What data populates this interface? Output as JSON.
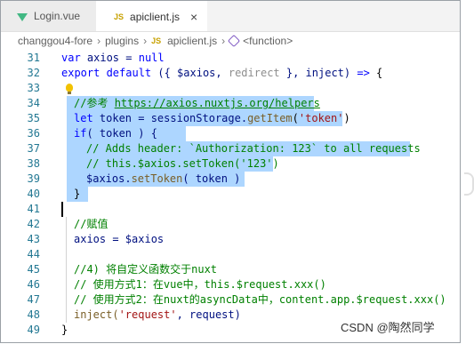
{
  "tabs": [
    {
      "label": "Login.vue",
      "icon": "vue-icon",
      "active": false
    },
    {
      "label": "apiclient.js",
      "icon": "js-icon",
      "active": true,
      "close": "×"
    }
  ],
  "js_badge": "JS",
  "breadcrumb": {
    "items": [
      "changgou4-fore",
      "plugins",
      "apiclient.js",
      "<function>"
    ],
    "separator": "›"
  },
  "colors": {
    "keyword": "#0000ff",
    "string": "#a31515",
    "comment": "#008000",
    "variable": "#001080",
    "function": "#795e26",
    "selection": "#add6ff",
    "line_number": "#237893"
  },
  "editor": {
    "lines": [
      {
        "n": "31",
        "t1": "var",
        "t2": " axios = ",
        "t3": "null"
      },
      {
        "n": "32",
        "t1": "export default",
        "t2": " ({ $axios, ",
        "t3": "redirect",
        "t4": " }, inject) ",
        "t5": "=>",
        "t6": " {"
      },
      {
        "n": "33"
      },
      {
        "n": "34",
        "t1": "//参考 ",
        "t2": "https://axios.nuxtjs.org/helpers"
      },
      {
        "n": "35",
        "t1": "let",
        "t2": " token = sessionStorage.",
        "t3": "getItem",
        "t4": "(",
        "t5": "'token'",
        "t6": ")"
      },
      {
        "n": "36",
        "t1": "if",
        "t2": "( token ) {"
      },
      {
        "n": "37",
        "t1": "// Adds header: `Authorization: 123` to all requests"
      },
      {
        "n": "38",
        "t1": "// this.$axios.setToken('123')"
      },
      {
        "n": "39",
        "t1": "$axios.",
        "t2": "setToken",
        "t3": "( token )"
      },
      {
        "n": "40",
        "t1": "}"
      },
      {
        "n": "41"
      },
      {
        "n": "42",
        "t1": "//赋值"
      },
      {
        "n": "43",
        "t1": "axios = $axios"
      },
      {
        "n": "44"
      },
      {
        "n": "45",
        "t1": "//4) 将自定义函数交于nuxt"
      },
      {
        "n": "46",
        "t1": "// 使用方式1：在vue中，this.$request.xxx()"
      },
      {
        "n": "47",
        "t1": "// 使用方式2：在nuxt的asyncData中，content.app.$request.xxx()"
      },
      {
        "n": "48",
        "t1": "inject(",
        "t2": "'request'",
        "t3": ", request)"
      },
      {
        "n": "49",
        "t1": "}"
      }
    ]
  },
  "watermark": "CSDN @陶然同学"
}
